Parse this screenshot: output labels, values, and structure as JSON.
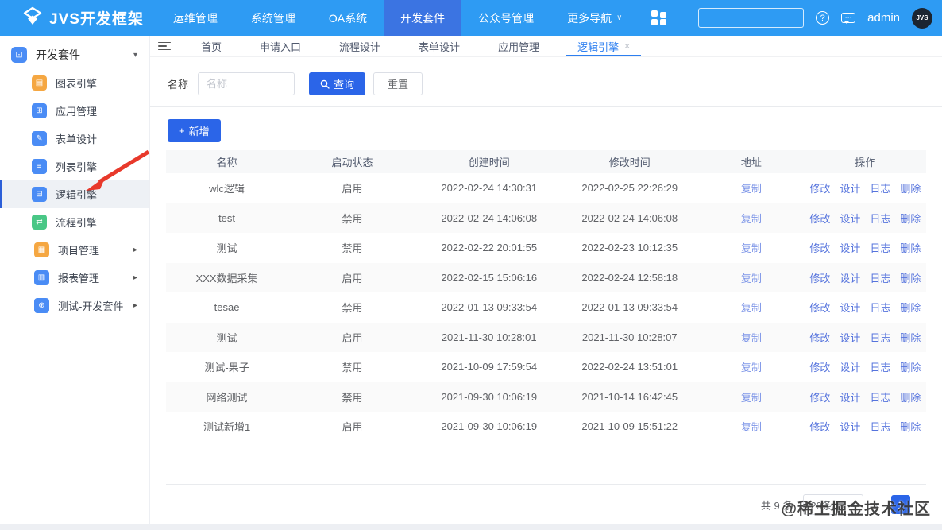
{
  "topnav": {
    "logo_title": "JVS开发框架",
    "items": [
      {
        "label": "运维管理",
        "active": false,
        "chevron": false
      },
      {
        "label": "系统管理",
        "active": false,
        "chevron": false
      },
      {
        "label": "OA系统",
        "active": false,
        "chevron": false
      },
      {
        "label": "开发套件",
        "active": true,
        "chevron": false
      },
      {
        "label": "公众号管理",
        "active": false,
        "chevron": false
      },
      {
        "label": "更多导航",
        "active": false,
        "chevron": true
      }
    ],
    "search_value": "",
    "admin_label": "admin",
    "avatar_text": "JVS"
  },
  "sidebar": {
    "group_label": "开发套件",
    "items": [
      {
        "label": "图表引擎",
        "icon": "chart-engine-icon",
        "color": "#f5a742",
        "glyph": "▤",
        "active": false
      },
      {
        "label": "应用管理",
        "icon": "app-manage-icon",
        "color": "#4a8cf5",
        "glyph": "⊞",
        "active": false
      },
      {
        "label": "表单设计",
        "icon": "form-design-icon",
        "color": "#4a8cf5",
        "glyph": "✎",
        "active": false
      },
      {
        "label": "列表引擎",
        "icon": "list-engine-icon",
        "color": "#4a8cf5",
        "glyph": "≡",
        "active": false
      },
      {
        "label": "逻辑引擎",
        "icon": "logic-engine-icon",
        "color": "#4a8cf5",
        "glyph": "⊟",
        "active": true
      },
      {
        "label": "流程引擎",
        "icon": "flow-engine-icon",
        "color": "#49c786",
        "glyph": "⇄",
        "active": false
      }
    ],
    "root_items": [
      {
        "label": "项目管理",
        "icon": "project-manage-icon",
        "color": "#f5a742",
        "glyph": "▦"
      },
      {
        "label": "报表管理",
        "icon": "report-manage-icon",
        "color": "#4a8cf5",
        "glyph": "▥"
      },
      {
        "label": "测试-开发套件",
        "icon": "test-devkit-icon",
        "color": "#4a8cf5",
        "glyph": "⊕"
      }
    ]
  },
  "tabs": [
    {
      "label": "首页",
      "active": false,
      "closable": false
    },
    {
      "label": "申请入口",
      "active": false,
      "closable": false
    },
    {
      "label": "流程设计",
      "active": false,
      "closable": false
    },
    {
      "label": "表单设计",
      "active": false,
      "closable": false
    },
    {
      "label": "应用管理",
      "active": false,
      "closable": false
    },
    {
      "label": "逻辑引擎",
      "active": true,
      "closable": true
    }
  ],
  "filter": {
    "name_label": "名称",
    "name_placeholder": "名称",
    "search_label": "查询",
    "reset_label": "重置"
  },
  "toolbar": {
    "add_label": "新增"
  },
  "table": {
    "columns": [
      "名称",
      "启动状态",
      "创建时间",
      "修改时间",
      "地址",
      "操作"
    ],
    "address_link_label": "复制",
    "op_labels": [
      "修改",
      "设计",
      "日志",
      "删除"
    ],
    "rows": [
      {
        "name": "wlc逻辑",
        "status": "启用",
        "created": "2022-02-24 14:30:31",
        "modified": "2022-02-25 22:26:29"
      },
      {
        "name": "test",
        "status": "禁用",
        "created": "2022-02-24 14:06:08",
        "modified": "2022-02-24 14:06:08"
      },
      {
        "name": "测试",
        "status": "禁用",
        "created": "2022-02-22 20:01:55",
        "modified": "2022-02-23 10:12:35"
      },
      {
        "name": "XXX数据采集",
        "status": "启用",
        "created": "2022-02-15 15:06:16",
        "modified": "2022-02-24 12:58:18"
      },
      {
        "name": "tesae",
        "status": "禁用",
        "created": "2022-01-13 09:33:54",
        "modified": "2022-01-13 09:33:54"
      },
      {
        "name": "测试",
        "status": "启用",
        "created": "2021-11-30 10:28:01",
        "modified": "2021-11-30 10:28:07"
      },
      {
        "name": "测试-果子",
        "status": "禁用",
        "created": "2021-10-09 17:59:54",
        "modified": "2022-02-24 13:51:01"
      },
      {
        "name": "网络测试",
        "status": "禁用",
        "created": "2021-09-30 10:06:19",
        "modified": "2021-10-14 16:42:45"
      },
      {
        "name": "测试新增1",
        "status": "启用",
        "created": "2021-09-30 10:06:19",
        "modified": "2021-10-09 15:51:22"
      }
    ]
  },
  "pagination": {
    "total_label": "共 9 条",
    "page_size_label": "20条/页",
    "current_page": "1"
  },
  "watermark": "@稀土掘金技术社区",
  "icons": {
    "chevron_down": "∨",
    "caret_down": "▾",
    "caret_right": "▸",
    "close": "×",
    "prev": "‹",
    "next": "›",
    "plus": "+",
    "dots": "⋯",
    "question": "?"
  },
  "colors": {
    "navbar": "#2e9bf3",
    "navbar_active": "#3b74e2",
    "primary_button": "#2b65e8",
    "link": "#5674dd",
    "link_light": "#7f97e8",
    "sidebar_active_border": "#2c5fd8",
    "annotation_arrow": "#e8392b"
  }
}
